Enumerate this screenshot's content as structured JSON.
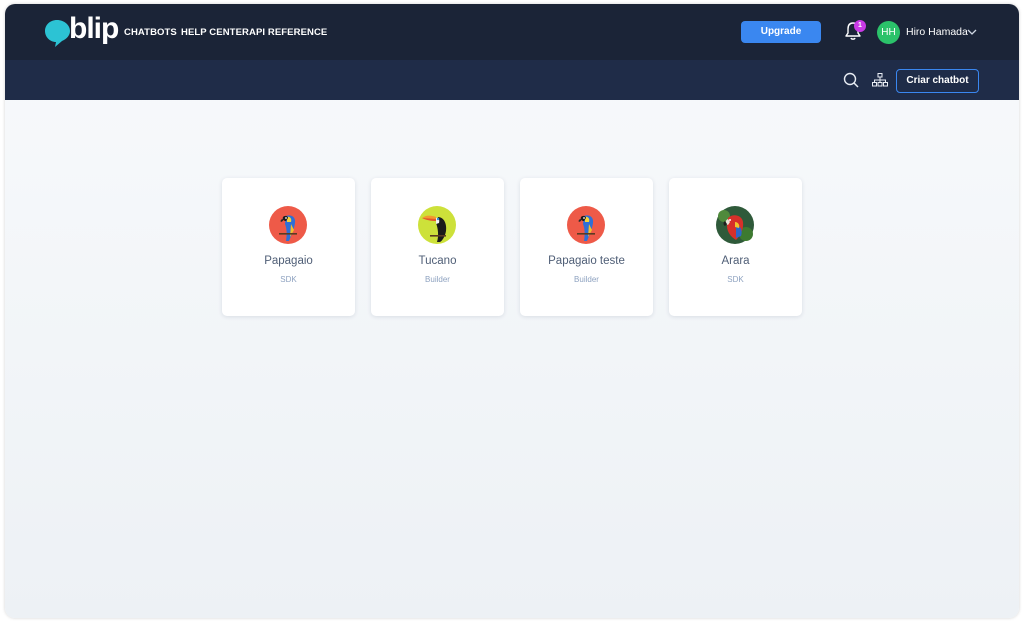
{
  "header": {
    "logo_text": "blip",
    "nav": [
      "CHATBOTS",
      "HELP CENTER",
      "API REFERENCE"
    ],
    "upgrade_label": "Upgrade",
    "notification_count": "1",
    "user_initials": "HH",
    "user_name": "Hiro Hamada"
  },
  "toolbar": {
    "create_label": "Criar chatbot"
  },
  "chatbots": [
    {
      "name": "Papagaio",
      "type": "SDK",
      "icon": "parrot-icon"
    },
    {
      "name": "Tucano",
      "type": "Builder",
      "icon": "toucan-icon"
    },
    {
      "name": "Papagaio teste",
      "type": "Builder",
      "icon": "parrot-icon"
    },
    {
      "name": "Arara",
      "type": "SDK",
      "icon": "macaw-icon"
    }
  ],
  "colors": {
    "topbar": "#1b2437",
    "subbar": "#1f2c48",
    "accent": "#3a87f0",
    "avatar": "#2bc26a",
    "badge": "#c93ae6",
    "logo": "#2cc3d4"
  }
}
